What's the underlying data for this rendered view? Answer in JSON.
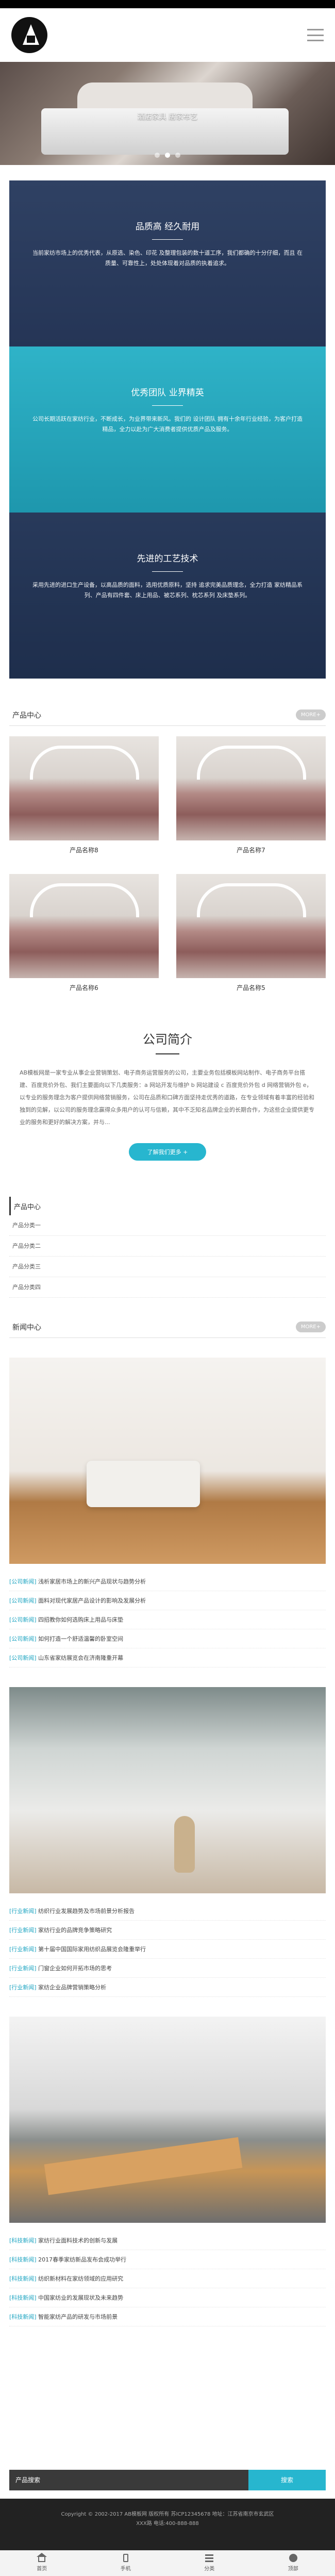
{
  "banner": {
    "caption": "酒店家具  居家布艺",
    "dot_count": 3
  },
  "features": [
    {
      "title": "品质高 经久耐用",
      "text": "当前家纺市场上的优秀代表，从原选、染色、印花 及整理包装的数十道工序，我们都确的十分仔细，而且 在质量、可靠性上，处处体现着对品质的执着追求。"
    },
    {
      "title": "优秀团队 业界精英",
      "text": "公司长期活跃在家纺行业，不断成长，为业界带来新风。我们的 设计团队 拥有十余年行业经验，为客户打造精品，全力以赴为广大消费者提供优质产品及服务。"
    },
    {
      "title": "先进的工艺技术",
      "text": "采用先进的进口生产设备，以高品质的面料，选用优质原料，坚持 追求完美品质理念，全力打造 家纺精品系列、产品有四件套、床上用品、被芯系列、枕芯系列 及床垫系列。"
    }
  ],
  "products_section": {
    "title": "产品中心",
    "more": "MORE+",
    "items": [
      {
        "caption": "产品名称8"
      },
      {
        "caption": "产品名称7"
      },
      {
        "caption": "产品名称6"
      },
      {
        "caption": "产品名称5"
      }
    ]
  },
  "company": {
    "title": "公司简介",
    "text": "AB模板网是一家专业从事企业营销策划、电子商务运营服务的公司，主要业务包括模板网站制作、电子商务平台搭建、百度竞价外包、我们主要面向以下几类服务：a 网站开发与维护 b 网站建设 c 百度竞价外包 d 网络营销外包 e，以专业的服务理念为客户提供网络营销服务，公司在品质和口碑方面坚持走优秀的道路，在专业领域有着丰富的经验和独到的见解，以公司的服务理念赢得众多用户的认可与信赖，其中不乏知名品牌企业的长期合作，为这些企业提供更专业的服务和更好的解决方案，并与...",
    "button": "了解我们更多 +"
  },
  "catnav": {
    "title": "产品中心",
    "items": [
      "产品分类一",
      "产品分类二",
      "产品分类三",
      "产品分类四"
    ]
  },
  "news_section": {
    "title": "新闻中心",
    "more": "MORE+",
    "groups": [
      {
        "items": [
          {
            "tag": "[公司新闻]",
            "text": "浅析家居市场上的新兴产品现状与趋势分析"
          },
          {
            "tag": "[公司新闻]",
            "text": "面料对现代家居产品设计的影响及发展分析"
          },
          {
            "tag": "[公司新闻]",
            "text": "四招教你如何选购床上用品与床垫"
          },
          {
            "tag": "[公司新闻]",
            "text": "如何打造一个舒适温馨的卧室空间"
          },
          {
            "tag": "[公司新闻]",
            "text": "山东省家纺展览会在济南隆重开幕"
          }
        ]
      },
      {
        "items": [
          {
            "tag": "[行业新闻]",
            "text": "纺织行业发展趋势及市场前景分析报告"
          },
          {
            "tag": "[行业新闻]",
            "text": "家纺行业的品牌竞争策略研究"
          },
          {
            "tag": "[行业新闻]",
            "text": "第十届中国国际家用纺织品展览会隆重举行"
          },
          {
            "tag": "[行业新闻]",
            "text": "门窗企业如何开拓市场的思考"
          },
          {
            "tag": "[行业新闻]",
            "text": "家纺企业品牌营销策略分析"
          }
        ]
      },
      {
        "items": [
          {
            "tag": "[科技新闻]",
            "text": "家纺行业面料技术的创新与发展"
          },
          {
            "tag": "[科技新闻]",
            "text": "2017春季家纺新品发布会成功举行"
          },
          {
            "tag": "[科技新闻]",
            "text": "纺织新材料在家纺领域的应用研究"
          },
          {
            "tag": "[科技新闻]",
            "text": "中国家纺业的发展现状及未来趋势"
          },
          {
            "tag": "[科技新闻]",
            "text": "智能家纺产品的研发与市场前景"
          }
        ]
      }
    ]
  },
  "search": {
    "placeholder": "产品搜索",
    "button": "搜索"
  },
  "footer": {
    "line1": "Copyright © 2002-2017 AB模板网 版权所有  苏ICP12345678 地址：江苏省南京市玄武区",
    "line2": "XXX路 电话:400-888-888"
  },
  "tabbar": {
    "items": [
      "首页",
      "手机",
      "分类",
      "顶部"
    ]
  }
}
